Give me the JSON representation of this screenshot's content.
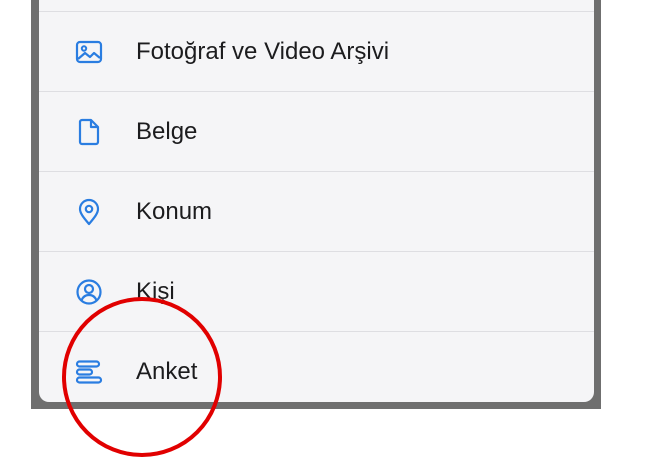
{
  "menu": {
    "items": [
      {
        "label": "Fotoğraf ve Video Arşivi",
        "icon": "photo-icon"
      },
      {
        "label": "Belge",
        "icon": "document-icon"
      },
      {
        "label": "Konum",
        "icon": "location-icon"
      },
      {
        "label": "Kişi",
        "icon": "contact-icon"
      },
      {
        "label": "Anket",
        "icon": "poll-icon"
      }
    ]
  },
  "colors": {
    "accent": "#2a7de1",
    "annotation": "#e10000"
  }
}
